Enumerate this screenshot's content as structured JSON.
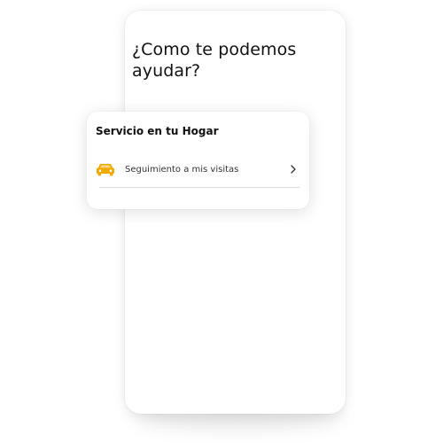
{
  "page": {
    "title": "¿Como te podemos ayudar?"
  },
  "card": {
    "title": "Servicio en tu Hogar",
    "items": [
      {
        "label": "Seguimiento a mis visitas",
        "icon": "car-icon",
        "trailing_icon": "chevron-right-icon"
      }
    ]
  },
  "colors": {
    "accent": "#F2A900",
    "background": "#FFFFFF",
    "text": "#111111",
    "divider": "#DCDCDC"
  }
}
